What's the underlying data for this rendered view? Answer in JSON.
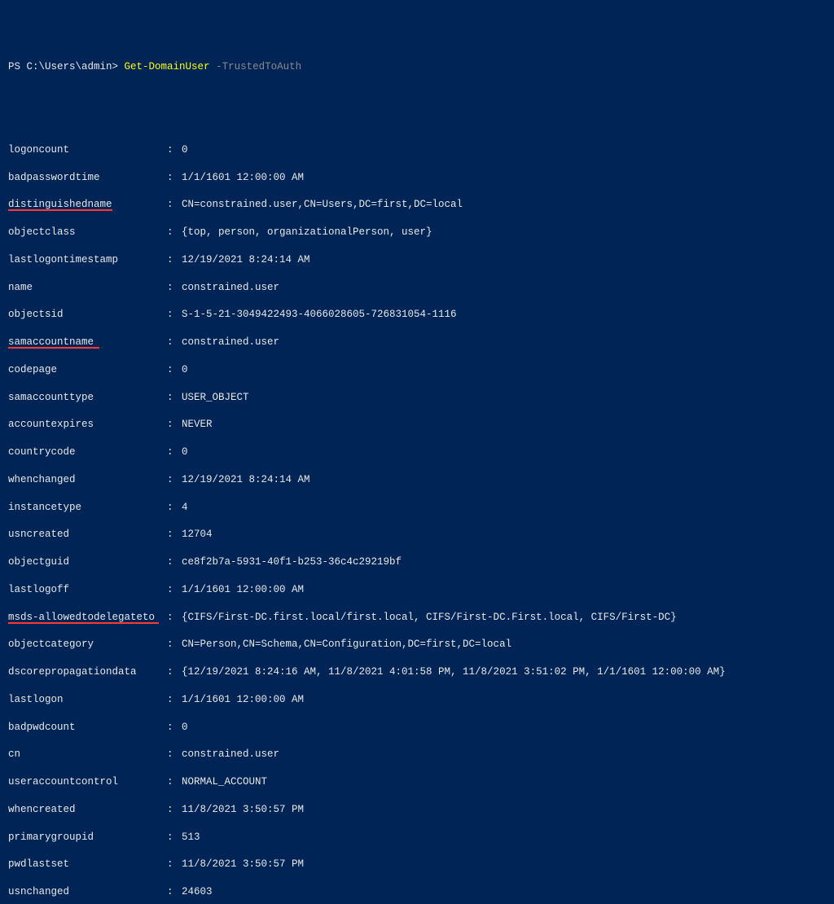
{
  "prompt": {
    "prefix": "PS C:\\Users\\admin> ",
    "cmdlet": "Get-DomainUser",
    "param": " -TrustedToAuth"
  },
  "props": {
    "logoncount": {
      "label": "logoncount",
      "value": "0"
    },
    "badpasswordtime": {
      "label": "badpasswordtime",
      "value": "1/1/1601 12:00:00 AM"
    },
    "distinguishedname": {
      "label": "distinguishedname",
      "value": "CN=constrained.user,CN=Users,DC=first,DC=local"
    },
    "objectclass": {
      "label": "objectclass",
      "value": "{top, person, organizationalPerson, user}"
    },
    "lastlogontimestamp": {
      "label": "lastlogontimestamp",
      "value": "12/19/2021 8:24:14 AM"
    },
    "name": {
      "label": "name",
      "value": "constrained.user"
    },
    "objectsid": {
      "label": "objectsid",
      "value": "S-1-5-21-3049422493-4066028605-726831054-1116"
    },
    "samaccountname": {
      "label": "samaccountname",
      "value": "constrained.user"
    },
    "codepage": {
      "label": "codepage",
      "value": "0"
    },
    "samaccounttype": {
      "label": "samaccounttype",
      "value": "USER_OBJECT"
    },
    "accountexpires": {
      "label": "accountexpires",
      "value": "NEVER"
    },
    "countrycode": {
      "label": "countrycode",
      "value": "0"
    },
    "whenchanged": {
      "label": "whenchanged",
      "value": "12/19/2021 8:24:14 AM"
    },
    "instancetype": {
      "label": "instancetype",
      "value": "4"
    },
    "usncreated": {
      "label": "usncreated",
      "value": "12704"
    },
    "objectguid": {
      "label": "objectguid",
      "value": "ce8f2b7a-5931-40f1-b253-36c4c29219bf"
    },
    "lastlogoff": {
      "label": "lastlogoff",
      "value": "1/1/1601 12:00:00 AM"
    },
    "msds": {
      "label": "msds-allowedtodelegateto",
      "value": "{CIFS/First-DC.first.local/first.local, CIFS/First-DC.First.local, CIFS/First-DC}"
    },
    "objectcategory": {
      "label": "objectcategory",
      "value": "CN=Person,CN=Schema,CN=Configuration,DC=first,DC=local"
    },
    "dscorepropagationdata": {
      "label": "dscorepropagationdata",
      "value": "{12/19/2021 8:24:16 AM, 11/8/2021 4:01:58 PM, 11/8/2021 3:51:02 PM, 1/1/1601 12:00:00 AM}"
    },
    "lastlogon": {
      "label": "lastlogon",
      "value": "1/1/1601 12:00:00 AM"
    },
    "badpwdcount": {
      "label": "badpwdcount",
      "value": "0"
    },
    "cn": {
      "label": "cn",
      "value": "constrained.user"
    },
    "useraccountcontrol": {
      "label": "useraccountcontrol",
      "value": "NORMAL_ACCOUNT"
    },
    "whencreated": {
      "label": "whencreated",
      "value": "11/8/2021 3:50:57 PM"
    },
    "primarygroupid": {
      "label": "primarygroupid",
      "value": "513"
    },
    "pwdlastset": {
      "label": "pwdlastset",
      "value": "11/8/2021 3:50:57 PM"
    },
    "usnchanged": {
      "label": "usnchanged",
      "value": "24603"
    }
  },
  "colon": ": "
}
